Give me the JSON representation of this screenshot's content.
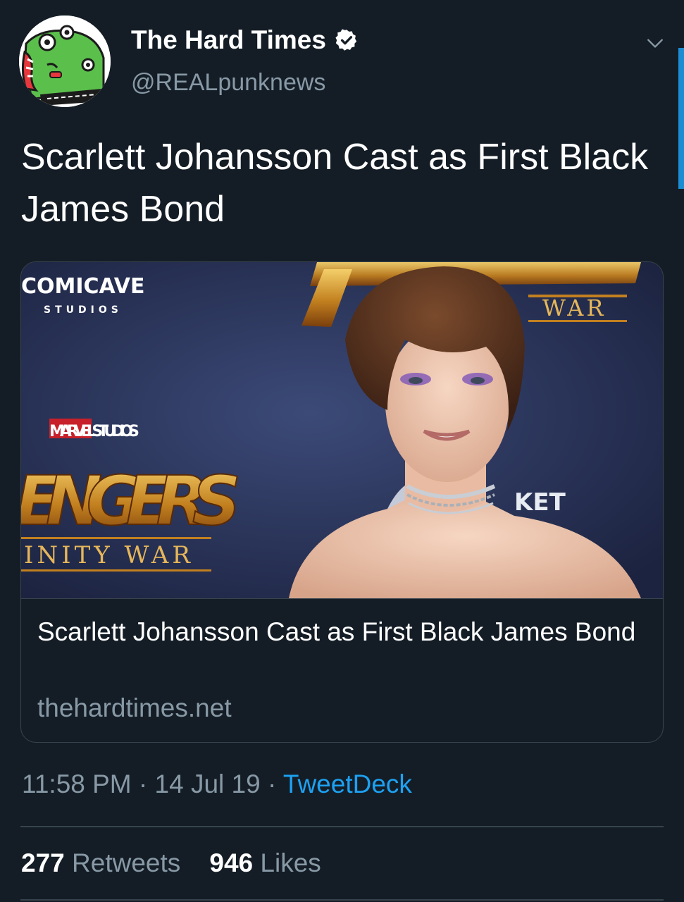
{
  "author": {
    "display_name": "The Hard Times",
    "handle": "@REALpunknews",
    "verified": true,
    "avatar_icon": "green-cartoon-monster-avatar"
  },
  "tweet": {
    "text": "Scarlett Johansson Cast as First Black James Bond"
  },
  "card": {
    "image": {
      "brand_top": "COMICAVE",
      "brand_sub": "STUDIOS",
      "marvel": "MARVEL STUDIOS",
      "avengers": "ENGERS",
      "infinity_war": "INITY WAR",
      "war_top": "WAR",
      "ticket_fragment": "KET"
    },
    "title": "Scarlett Johansson Cast as First Black James Bond",
    "domain": "thehardtimes.net"
  },
  "meta": {
    "time": "11:58 PM",
    "sep1": " · ",
    "date": "14 Jul 19",
    "sep2": " · ",
    "source": "TweetDeck"
  },
  "stats": {
    "retweets_count": "277",
    "retweets_label": "Retweets",
    "likes_count": "946",
    "likes_label": "Likes"
  },
  "colors": {
    "background": "#141d26",
    "secondary_text": "#8899a6",
    "accent": "#1da1f2",
    "border": "#38444d"
  }
}
